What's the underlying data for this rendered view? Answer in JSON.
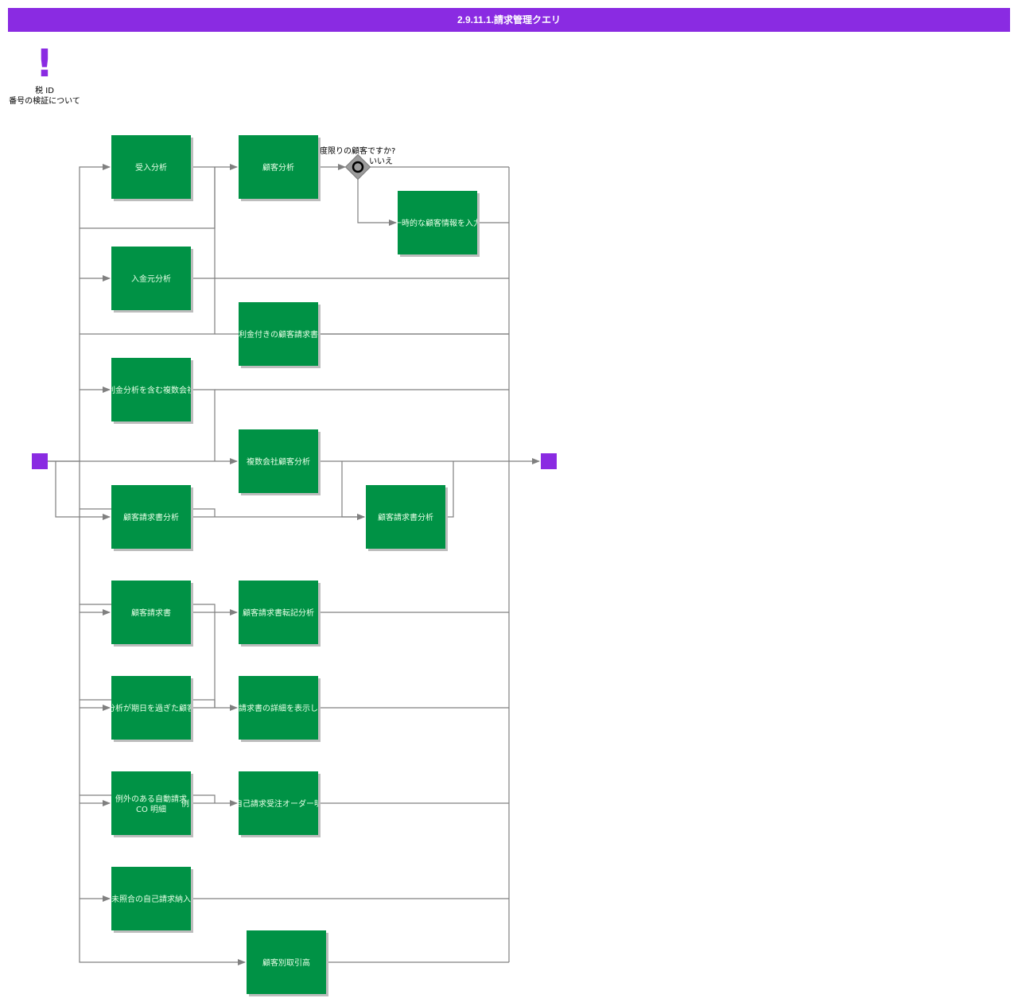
{
  "title": "2.9.11.1.請求管理クエリ",
  "info_note": {
    "icon": "!",
    "line1": "税 ID",
    "line2": "番号の検証について"
  },
  "colors": {
    "accent": "#8a2be2",
    "task": "#009245",
    "edge": "#808080"
  },
  "gateway": {
    "question": "一度限りの顧客ですか?",
    "no_label": "いいえ"
  },
  "tasks": {
    "juunyuu": "受入分析",
    "kokyaku": "顧客分析",
    "ichiji_nyuuryoku": "一時的な顧客情報を入力",
    "nyuukinmoto": "入金元分析",
    "kinri": "利金付きの顧客請求書",
    "fukusuu_kaisha_kin": "利金分析を含む複数会社",
    "fukusuu_kokyaku": "複数会社顧客分析",
    "seikyuusho_bunseki_1": "顧客請求書分析",
    "seikyuusho_bunseki_2": "顧客請求書分析",
    "seikyuusho": "顧客請求書",
    "tenki": "顧客請求書転記分析",
    "kijitsu": "分析が期日を過ぎた顧客",
    "shousai": "請求書の詳細を表示し",
    "jidou_line1": "例外のある自動請求",
    "jidou_line2": "CO 明細",
    "jidou_side": "例",
    "juchuu": "自己請求受注オーダー明",
    "mishougou": "未照合の自己請求納入",
    "torihikidaka": "顧客別取引高"
  }
}
